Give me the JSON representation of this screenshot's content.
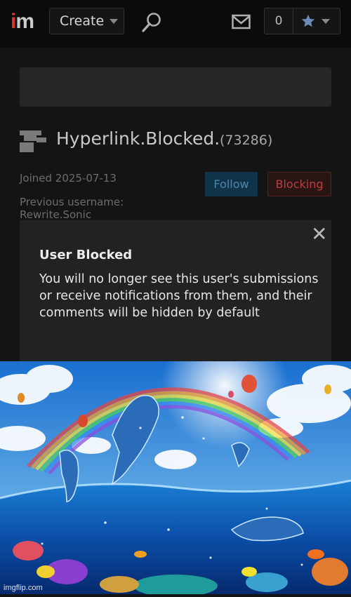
{
  "topbar": {
    "logo_i": "i",
    "logo_m": "m",
    "create_label": "Create",
    "count": "0"
  },
  "profile": {
    "username": "Hyperlink.Blocked.",
    "user_id": "(73286)",
    "joined": "Joined 2025-07-13",
    "previous_username": "Previous username: Rewrite.Sonic",
    "follow_label": "Follow",
    "blocking_label": "Blocking"
  },
  "modal": {
    "close_glyph": "✕",
    "title": "User Blocked",
    "body": "You will no longer see this user's submissions or receive notifications from them, and their comments will be hidden by default"
  },
  "image": {
    "watermark": "imgflip.com"
  },
  "colors": {
    "background": "#141414",
    "topbar": "#0b0b0b",
    "logo_i": "#dd3333",
    "follow_bg": "#10334a",
    "follow_text": "#4c86ad",
    "blocking_text": "#b84040",
    "modal_bg": "#222222"
  }
}
